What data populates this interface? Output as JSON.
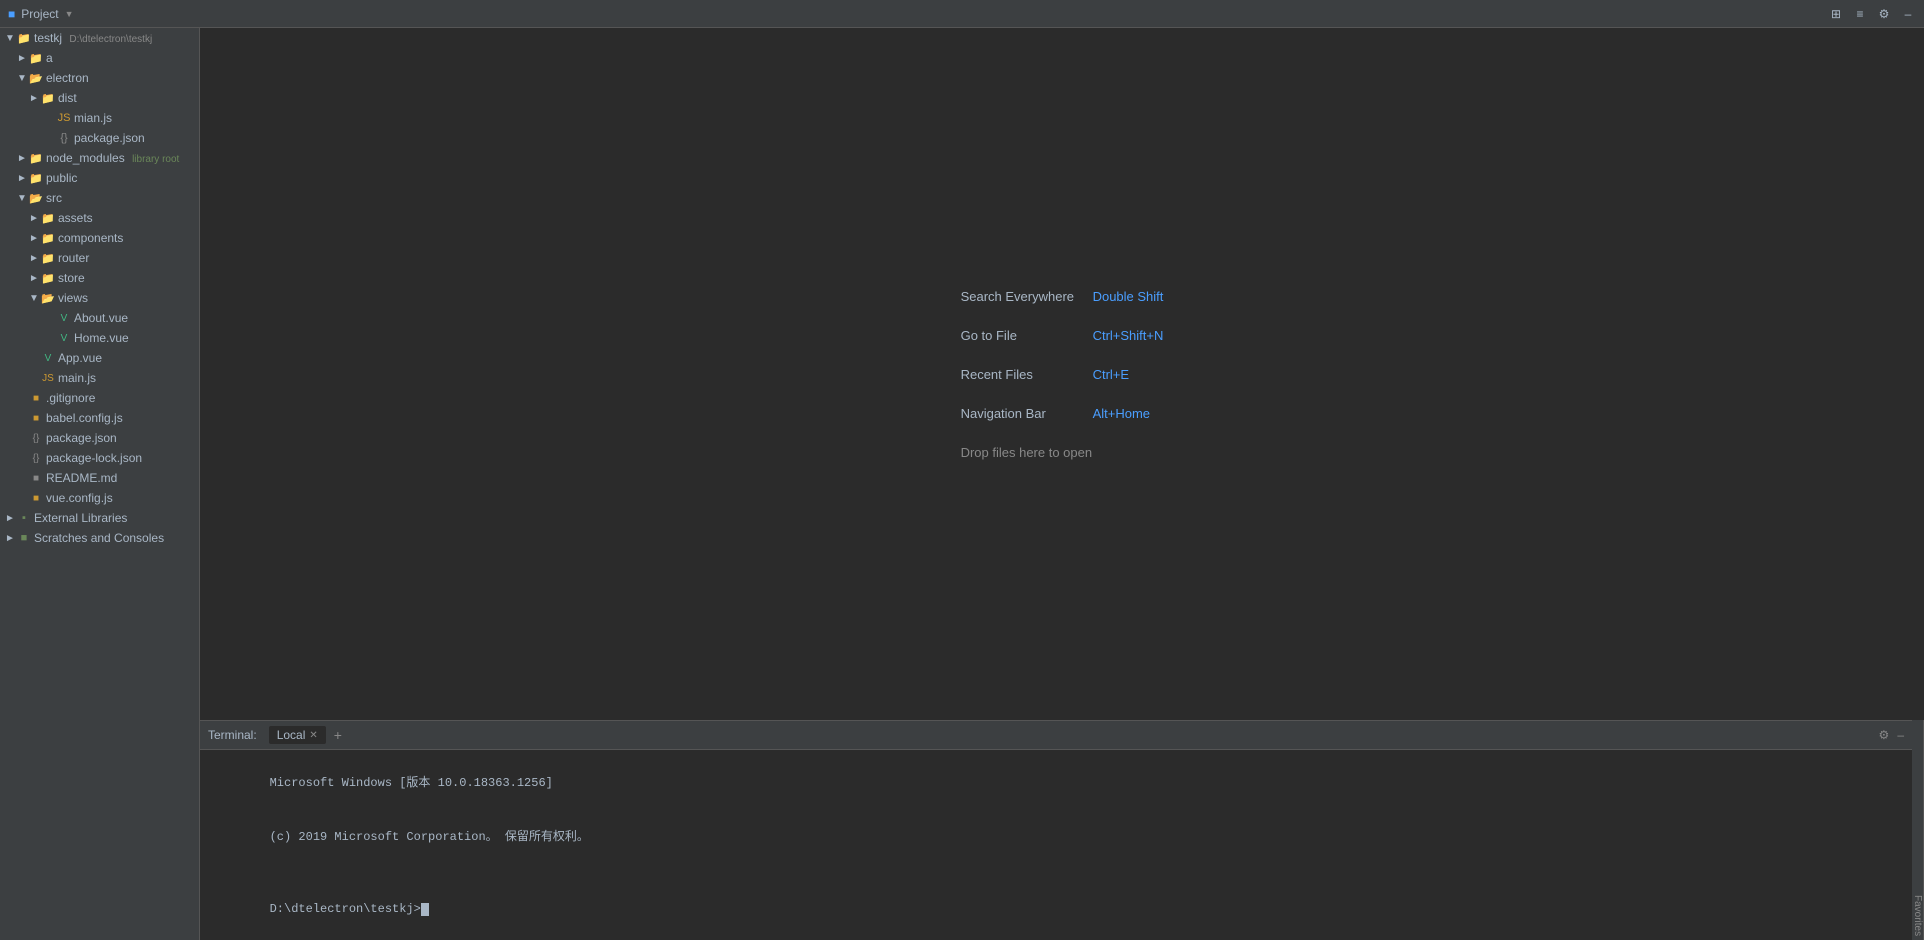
{
  "titlebar": {
    "project_label": "Project",
    "icons": [
      "grid-icon",
      "list-icon",
      "gear-icon",
      "minimize-icon"
    ]
  },
  "sidebar": {
    "root": {
      "name": "testkj",
      "path": "D:\\dtelectron\\testkj",
      "children": [
        {
          "id": "a",
          "label": "a",
          "type": "folder",
          "depth": 1,
          "open": false
        },
        {
          "id": "electron",
          "label": "electron",
          "type": "folder",
          "depth": 1,
          "open": true,
          "children": [
            {
              "id": "dist",
              "label": "dist",
              "type": "folder",
              "depth": 2,
              "open": false
            },
            {
              "id": "mian.js",
              "label": "mian.js",
              "type": "file-js",
              "depth": 3
            },
            {
              "id": "package.json-e",
              "label": "package.json",
              "type": "file-json",
              "depth": 3
            }
          ]
        },
        {
          "id": "node_modules",
          "label": "node_modules",
          "type": "folder",
          "depth": 1,
          "open": false,
          "badge": "library root"
        },
        {
          "id": "public",
          "label": "public",
          "type": "folder",
          "depth": 1,
          "open": false
        },
        {
          "id": "src",
          "label": "src",
          "type": "folder",
          "depth": 1,
          "open": true,
          "children": [
            {
              "id": "assets",
              "label": "assets",
              "type": "folder",
              "depth": 2,
              "open": false
            },
            {
              "id": "components",
              "label": "components",
              "type": "folder",
              "depth": 2,
              "open": false
            },
            {
              "id": "router",
              "label": "router",
              "type": "folder",
              "depth": 2,
              "open": false
            },
            {
              "id": "store",
              "label": "store",
              "type": "folder",
              "depth": 2,
              "open": false
            },
            {
              "id": "views",
              "label": "views",
              "type": "folder",
              "depth": 2,
              "open": true,
              "children": [
                {
                  "id": "About.vue",
                  "label": "About.vue",
                  "type": "file-vue",
                  "depth": 3
                },
                {
                  "id": "Home.vue",
                  "label": "Home.vue",
                  "type": "file-vue",
                  "depth": 3
                }
              ]
            },
            {
              "id": "App.vue",
              "label": "App.vue",
              "type": "file-vue",
              "depth": 2
            },
            {
              "id": "main.js",
              "label": "main.js",
              "type": "file-js",
              "depth": 2
            }
          ]
        },
        {
          "id": "gitignore",
          "label": ".gitignore",
          "type": "file-git",
          "depth": 1
        },
        {
          "id": "babel.config.js",
          "label": "babel.config.js",
          "type": "file-babel",
          "depth": 1
        },
        {
          "id": "package.json",
          "label": "package.json",
          "type": "file-json",
          "depth": 1
        },
        {
          "id": "package-lock.json",
          "label": "package-lock.json",
          "type": "file-json",
          "depth": 1
        },
        {
          "id": "README.md",
          "label": "README.md",
          "type": "file-md",
          "depth": 1
        },
        {
          "id": "vue.config.js",
          "label": "vue.config.js",
          "type": "file-config",
          "depth": 1
        }
      ]
    },
    "external_libraries": "External Libraries",
    "scratches": "Scratches and Consoles"
  },
  "welcome": {
    "search_everywhere_label": "Search Everywhere",
    "search_everywhere_shortcut": "Double Shift",
    "go_to_file_label": "Go to File",
    "go_to_file_shortcut": "Ctrl+Shift+N",
    "recent_files_label": "Recent Files",
    "recent_files_shortcut": "Ctrl+E",
    "navigation_bar_label": "Navigation Bar",
    "navigation_bar_shortcut": "Alt+Home",
    "drop_files_label": "Drop files here to open"
  },
  "terminal": {
    "label": "Terminal:",
    "tab_local": "Local",
    "tab_add": "+",
    "line1": "Microsoft Windows [版本 10.0.18363.1256]",
    "line2": "(c) 2019 Microsoft Corporation。 保留所有权利。",
    "line3": "",
    "prompt": "D:\\dtelectron\\testkj>"
  },
  "favorites": "Favorites"
}
